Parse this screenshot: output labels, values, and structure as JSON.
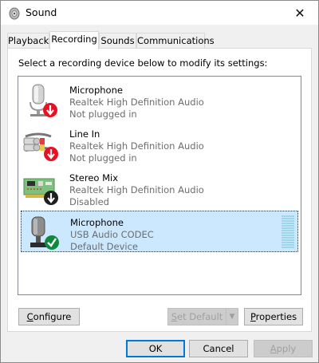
{
  "window": {
    "title": "Sound",
    "close_symbol": "✕"
  },
  "tabs": [
    {
      "label": "Playback",
      "active": false
    },
    {
      "label": "Recording",
      "active": true
    },
    {
      "label": "Sounds",
      "active": false
    },
    {
      "label": "Communications",
      "active": false
    }
  ],
  "instruction": "Select a recording device below to modify its settings:",
  "devices": [
    {
      "name": "Microphone",
      "driver": "Realtek High Definition Audio",
      "status": "Not plugged in",
      "icon": "microphone-icon",
      "badge": "red-down-arrow",
      "selected": false
    },
    {
      "name": "Line In",
      "driver": "Realtek High Definition Audio",
      "status": "Not plugged in",
      "icon": "line-in-cable-icon",
      "badge": "red-down-arrow",
      "selected": false
    },
    {
      "name": "Stereo Mix",
      "driver": "Realtek High Definition Audio",
      "status": "Disabled",
      "icon": "sound-card-icon",
      "badge": "black-down-arrow",
      "selected": false
    },
    {
      "name": "Microphone",
      "driver": "USB Audio CODEC",
      "status": "Default Device",
      "icon": "usb-microphone-icon",
      "badge": "green-check",
      "selected": true
    }
  ],
  "buttons": {
    "configure": {
      "prefix": "",
      "underlined": "C",
      "rest": "onfigure"
    },
    "set_default": {
      "prefix": "",
      "underlined": "S",
      "rest": "et Default",
      "disabled": true
    },
    "properties": {
      "prefix": "",
      "underlined": "P",
      "rest": "roperties"
    },
    "ok": "OK",
    "cancel": "Cancel",
    "apply": {
      "prefix": "",
      "underlined": "A",
      "rest": "pply",
      "disabled": true
    }
  },
  "colors": {
    "selection": "#cce8ff",
    "accent": "#0078d7",
    "level_meter": "#9fd7ea"
  }
}
